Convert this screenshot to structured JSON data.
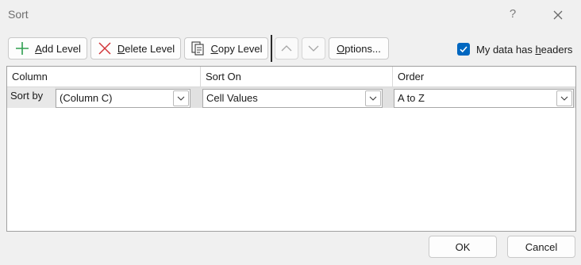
{
  "window": {
    "title": "Sort",
    "help_glyph": "?"
  },
  "toolbar": {
    "add_level": {
      "mnemonic": "A",
      "rest": "dd Level"
    },
    "delete_level": {
      "mnemonic": "D",
      "rest": "elete Level"
    },
    "copy_level": {
      "mnemonic": "C",
      "rest": "opy Level"
    },
    "options": {
      "mnemonic": "O",
      "rest": "ptions..."
    }
  },
  "headers_checkbox": {
    "checked": true,
    "label_prefix": "My data has ",
    "label_mnemonic": "h",
    "label_suffix": "eaders"
  },
  "grid": {
    "columns": [
      "Column",
      "Sort On",
      "Order"
    ],
    "rows": [
      {
        "label": "Sort by",
        "column": "(Column C)",
        "sort_on": "Cell Values",
        "order": "A to Z"
      }
    ]
  },
  "footer": {
    "ok": "OK",
    "cancel": "Cancel"
  },
  "colors": {
    "accent": "#0067c0",
    "add_icon": "#2e9e4f",
    "delete_icon": "#d13438"
  },
  "icons": [
    "close-icon",
    "plus-icon",
    "delete-x-icon",
    "copy-icon",
    "arrow-up-icon",
    "arrow-down-icon",
    "checkmark-icon",
    "chevron-down-icon"
  ]
}
